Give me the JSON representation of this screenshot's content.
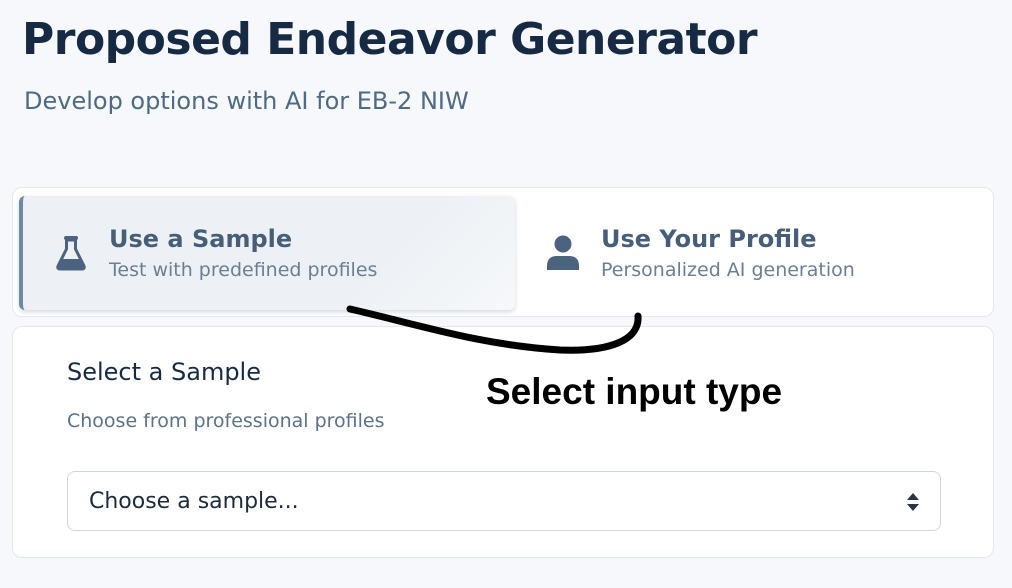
{
  "header": {
    "title": "Proposed Endeavor Generator",
    "subtitle": "Develop options with AI for EB-2 NIW"
  },
  "input_tabs": {
    "selected": "sample",
    "sample": {
      "icon": "flask-icon",
      "title": "Use a Sample",
      "description": "Test with predefined profiles"
    },
    "profile": {
      "icon": "user-icon",
      "title": "Use Your Profile",
      "description": "Personalized AI generation"
    }
  },
  "sample_card": {
    "title": "Select a Sample",
    "description": "Choose from professional profiles",
    "select": {
      "value": "Choose a sample...",
      "icon": "sort-arrows-icon"
    }
  },
  "annotation": {
    "label": "Select input type",
    "color": "#000000"
  },
  "colors": {
    "title": "#172a44",
    "accent": "#6f88a6",
    "icon": "#4c6380",
    "background": "#f6f8fb"
  }
}
